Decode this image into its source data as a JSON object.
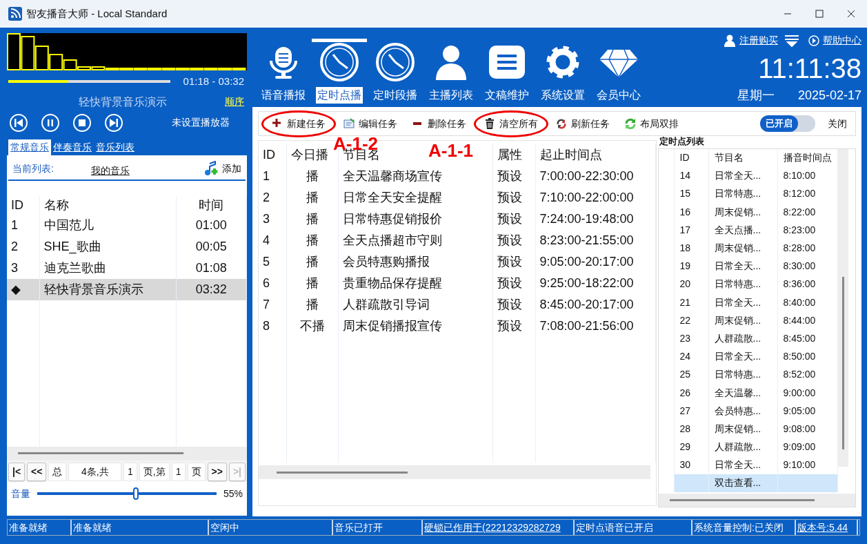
{
  "window": {
    "title": "智友播音大师 - Local Standard"
  },
  "player": {
    "time": "01:18 - 03:32",
    "level": 0.37,
    "song": "轻快背景音乐演示",
    "mode": "顺序",
    "player_status": "未设置播放器"
  },
  "music_tabs": [
    {
      "label": "常规音乐",
      "selected": true
    },
    {
      "label": "伴奏音乐",
      "selected": false
    },
    {
      "label": "音乐列表",
      "selected": false
    }
  ],
  "playlist": {
    "label": "当前列表:",
    "name": "我的音乐",
    "add": "添加",
    "columns": [
      "ID",
      "名称",
      "时间"
    ],
    "rows": [
      {
        "id": "1",
        "name": "中国范儿",
        "time": "01:00",
        "selected": false
      },
      {
        "id": "2",
        "name": "SHE_歌曲",
        "time": "00:05",
        "selected": false
      },
      {
        "id": "3",
        "name": "迪克兰歌曲",
        "time": "01:08",
        "selected": false
      },
      {
        "id": "◆",
        "name": "轻快背景音乐演示",
        "time": "03:32",
        "selected": true
      }
    ]
  },
  "pager": [
    {
      "label": "|<",
      "kind": "button",
      "disabled": false
    },
    {
      "label": "<<",
      "kind": "button",
      "disabled": false
    },
    {
      "label": "总",
      "kind": "label",
      "disabled": false
    },
    {
      "label": "4条,共",
      "kind": "label",
      "disabled": false
    },
    {
      "label": "1",
      "kind": "label",
      "disabled": false
    },
    {
      "label": "页,第",
      "kind": "label",
      "disabled": false
    },
    {
      "label": "1",
      "kind": "label",
      "disabled": false
    },
    {
      "label": "页",
      "kind": "label",
      "disabled": false
    },
    {
      "label": ">>",
      "kind": "button",
      "disabled": false
    },
    {
      "label": ">|",
      "kind": "button",
      "disabled": true
    }
  ],
  "volume": {
    "label": "音量",
    "level": 0.55,
    "reading": "55%"
  },
  "nav": [
    {
      "label": "语音播报",
      "kind": "mic",
      "selected": false
    },
    {
      "label": "定时点播",
      "kind": "clock",
      "selected": true
    },
    {
      "label": "定时段播",
      "kind": "clock",
      "selected": false
    },
    {
      "label": "主播列表",
      "kind": "person",
      "selected": false
    },
    {
      "label": "文稿维护",
      "kind": "doc",
      "selected": false
    },
    {
      "label": "系统设置",
      "kind": "gear",
      "selected": false
    },
    {
      "label": "会员中心",
      "kind": "diamond",
      "selected": false
    }
  ],
  "top_links": {
    "register": "注册购买",
    "help": "帮助中心"
  },
  "clock": {
    "time": "11:11:38",
    "weekday": "星期一",
    "date": "2025-02-17"
  },
  "toolbar": [
    {
      "label": "新建任务",
      "kind": "add",
      "circled": true
    },
    {
      "label": "编辑任务",
      "kind": "edit",
      "circled": false
    },
    {
      "label": "删除任务",
      "kind": "remove",
      "circled": false
    },
    {
      "label": "清空所有",
      "kind": "trash",
      "circled": true
    },
    {
      "label": "刷新任务",
      "kind": "refresh",
      "circled": false
    },
    {
      "label": "布局双排",
      "kind": "layout",
      "circled": false
    }
  ],
  "switch": {
    "on_label": "已开启",
    "off_label": "关闭",
    "on": true
  },
  "annotations": [
    {
      "label": "A-1-2"
    },
    {
      "label": "A-1-1"
    }
  ],
  "tasks": {
    "columns": [
      "ID",
      "今日播",
      "节目名",
      "属性",
      "起止时间点"
    ],
    "rows": [
      {
        "id": "1",
        "today": "播",
        "name": "全天温馨商场宣传",
        "attr": "预设",
        "range": "7:00:00-22:30:00"
      },
      {
        "id": "2",
        "today": "播",
        "name": "日常全天安全提醒",
        "attr": "预设",
        "range": "7:10:00-22:00:00"
      },
      {
        "id": "3",
        "today": "播",
        "name": "日常特惠促销报价",
        "attr": "预设",
        "range": "7:24:00-19:48:00"
      },
      {
        "id": "4",
        "today": "播",
        "name": "全天点播超市守则",
        "attr": "预设",
        "range": "8:23:00-21:55:00"
      },
      {
        "id": "5",
        "today": "播",
        "name": "会员特惠购播报",
        "attr": "预设",
        "range": "9:05:00-20:17:00"
      },
      {
        "id": "6",
        "today": "播",
        "name": "贵重物品保存提醒",
        "attr": "预设",
        "range": "9:25:00-18:22:00"
      },
      {
        "id": "7",
        "today": "播",
        "name": "人群疏散引导词",
        "attr": "预设",
        "range": "8:45:00-20:17:00"
      },
      {
        "id": "8",
        "today": "不播",
        "name": "周末促销播报宣传",
        "attr": "预设",
        "range": "7:08:00-21:56:00"
      }
    ]
  },
  "timepoints": {
    "title": "定时点列表",
    "columns": [
      "ID",
      "节目名",
      "播音时间点"
    ],
    "rows": [
      {
        "id": "14",
        "name": "日常全天...",
        "time": "8:10:00"
      },
      {
        "id": "15",
        "name": "日常特惠...",
        "time": "8:12:00"
      },
      {
        "id": "16",
        "name": "周末促销...",
        "time": "8:22:00"
      },
      {
        "id": "17",
        "name": "全天点播...",
        "time": "8:23:00"
      },
      {
        "id": "18",
        "name": "周末促销...",
        "time": "8:28:00"
      },
      {
        "id": "19",
        "name": "日常全天...",
        "time": "8:30:00"
      },
      {
        "id": "20",
        "name": "日常特惠...",
        "time": "8:36:00"
      },
      {
        "id": "21",
        "name": "日常全天...",
        "time": "8:40:00"
      },
      {
        "id": "22",
        "name": "周末促销...",
        "time": "8:44:00"
      },
      {
        "id": "23",
        "name": "人群疏散...",
        "time": "8:45:00"
      },
      {
        "id": "24",
        "name": "日常全天...",
        "time": "8:50:00"
      },
      {
        "id": "25",
        "name": "日常特惠...",
        "time": "8:52:00"
      },
      {
        "id": "26",
        "name": "全天温馨...",
        "time": "9:00:00"
      },
      {
        "id": "27",
        "name": "会员特惠...",
        "time": "9:05:00"
      },
      {
        "id": "28",
        "name": "周末促销...",
        "time": "9:08:00"
      },
      {
        "id": "29",
        "name": "人群疏散...",
        "time": "9:09:00"
      },
      {
        "id": "30",
        "name": "日常全天...",
        "time": "9:10:00"
      }
    ],
    "footer": {
      "name": "双击查看...",
      "selected": true
    }
  },
  "status_bar": [
    {
      "text": "准备就绪",
      "link": false
    },
    {
      "text": "准备就绪",
      "link": false
    },
    {
      "text": "空闲中",
      "link": false
    },
    {
      "text": "音乐已打开",
      "link": false
    },
    {
      "text": "硬锁已作用于(22212329282729",
      "link": true
    },
    {
      "text": "定时点语音已开启",
      "link": false
    },
    {
      "text": "系统音量控制:已关闭",
      "link": false
    },
    {
      "text": "版本号:5.44",
      "link": true
    }
  ]
}
